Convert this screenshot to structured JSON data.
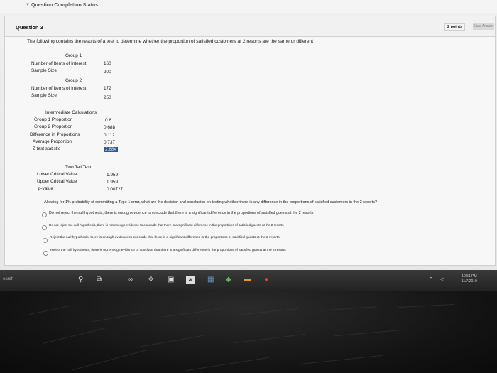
{
  "status_bar": {
    "title": "Question Completion Status:"
  },
  "question": {
    "title": "Question 3",
    "points": "2 points",
    "save_label": "Save Answer",
    "prompt": "The following contains the results of a test to determine whether the proportion of satisfied customers at 2 resorts are the same or different",
    "group1": {
      "heading": "Group 1",
      "items_label": "Number of Items of Interest",
      "items_value": "160",
      "size_label": "Sample Size",
      "size_value": "200"
    },
    "group2": {
      "heading": "Group 2",
      "items_label": "Number of Items of Interest",
      "items_value": "172",
      "size_label": "Sample Size",
      "size_value": "250"
    },
    "intermediate": {
      "heading": "Intermediate Calculations",
      "rows": [
        {
          "label": "Group 1 Proportion",
          "value": "0.8"
        },
        {
          "label": "Group 2 Proportion",
          "value": "0.688"
        },
        {
          "label": "Difference in Proportions",
          "value": "0.112"
        },
        {
          "label": "Average Proportion",
          "value": "0.737"
        },
        {
          "label": "Z test statistic",
          "value": "2.684"
        }
      ]
    },
    "two_tail": {
      "heading": "Two Tail Test",
      "rows": [
        {
          "label": "Lower Critical Value",
          "value": "-1.959"
        },
        {
          "label": "Upper Critical Value",
          "value": "1.959"
        },
        {
          "label": "p-value",
          "value": "0.00727"
        }
      ]
    },
    "ask": "Allowing for 1% probability of committing a Type 1 error, what are the decision and conclusion on testing whether there is any difference in the proportions of satisfied customers in the 2 resorts?",
    "options": [
      "Do not reject the null hypothesis; there is enough evidence to conclude that there is a significant difference in the proportions of satisfied guests at the 2 resorts",
      "Do not reject the null hypothesis, there is not enough evidence to conclude that there is a significant difference in the proportions of satisfied guests at the 2 resorts",
      "Reject the null hypothesis, there is enough evidence to conclude that there is a significant difference in the proportions of satisfied guests at the 2 resorts",
      "Reject the null hypothesis, there is not enough evidence to conclude that there is a significant difference in the proportions of satisfied guests at the 2 resorts"
    ]
  },
  "taskbar": {
    "search_label": "earch",
    "time": "10:51 PM",
    "date": "11/7/2019"
  },
  "colors": {
    "highlight": "#2f5a8f",
    "taskbar": "#2a2a2a"
  }
}
